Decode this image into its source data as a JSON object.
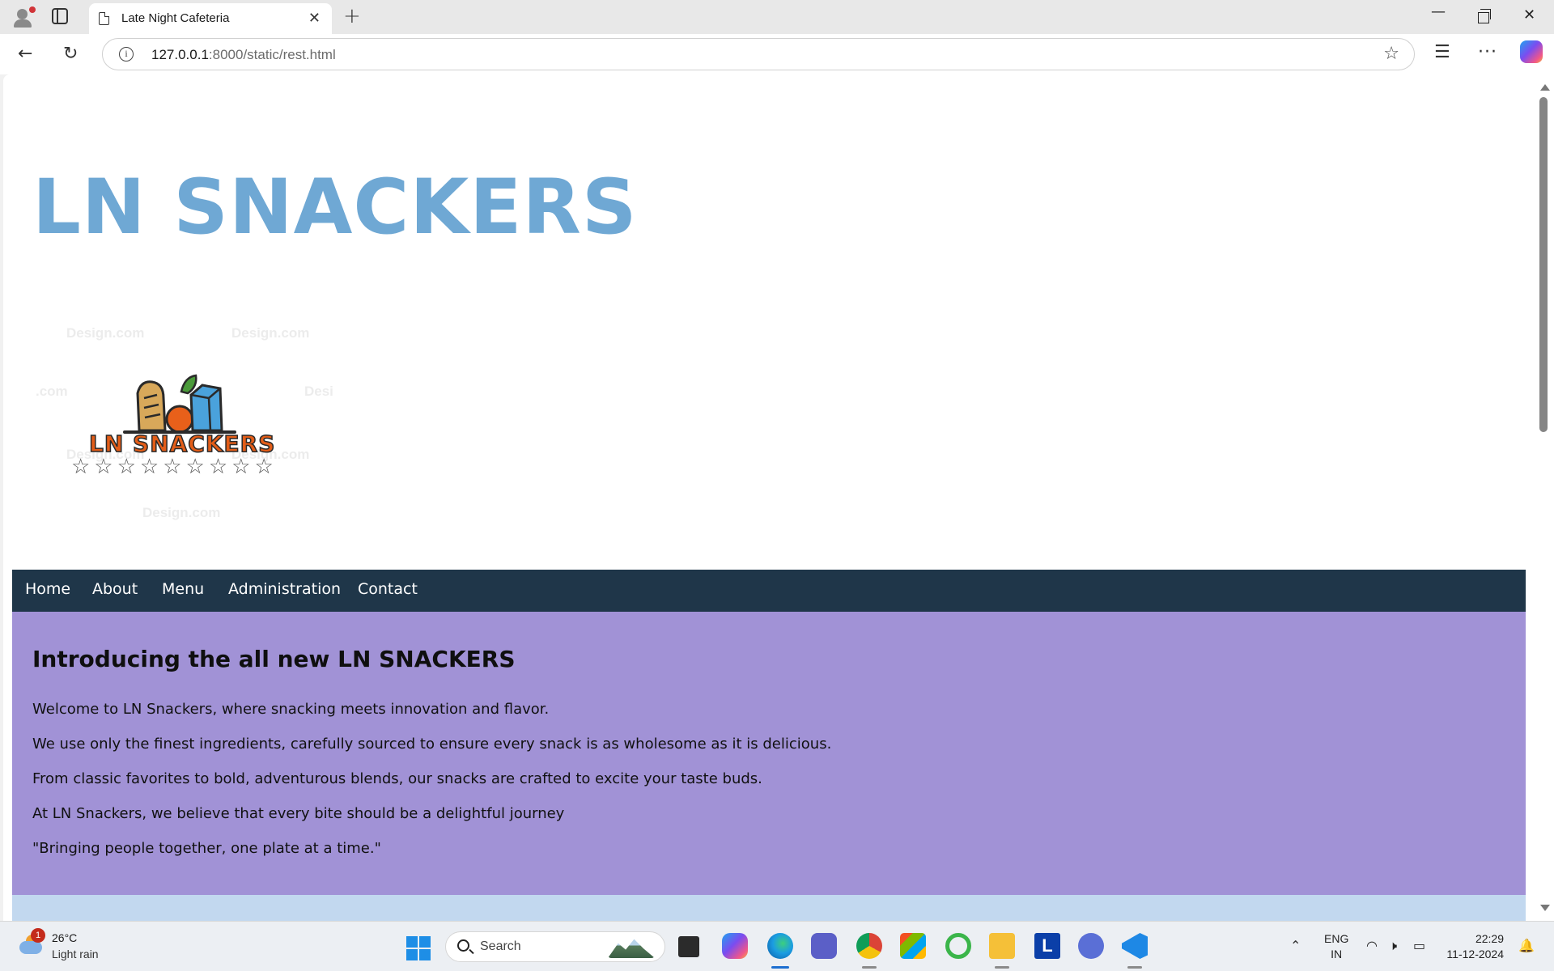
{
  "browser": {
    "tab_title": "Late Night Cafeteria",
    "tab_close_glyph": "✕",
    "new_tab_glyph": "+",
    "url_host": "127.0.0.1",
    "url_rest": ":8000/static/rest.html",
    "window_controls": {
      "minimize": "—",
      "close": "✕"
    },
    "more_glyph": "···"
  },
  "page": {
    "title": "LN SNACKERS",
    "logo_text": "LN SNACKERS",
    "stars": "☆☆☆☆☆☆☆☆☆",
    "watermarks": [
      "Design.com",
      "Design.com",
      ".com",
      "Desi",
      "Design.com",
      "Design.com",
      "Design.com"
    ],
    "nav": [
      "Home",
      "About",
      "Menu",
      "Administration",
      "Contact"
    ],
    "intro": {
      "heading": "Introducing the all new LN SNACKERS",
      "lines": [
        "Welcome to LN Snackers, where snacking meets innovation and flavor.",
        "We use only the finest ingredients, carefully sourced to ensure every snack is as wholesome as it is delicious.",
        "From classic favorites to bold, adventurous blends, our snacks are crafted to excite your taste buds.",
        "At LN Snackers, we believe that every bite should be a delightful journey",
        "\"Bringing people together, one plate at a time.\""
      ]
    },
    "colors": {
      "title": "#6fa8d4",
      "nav_bg": "#1f3649",
      "intro_bg": "#a192d6",
      "next_section_bg": "#c2d8ef"
    }
  },
  "taskbar": {
    "weather_badge": "1",
    "weather_temp": "26°C",
    "weather_desc": "Light rain",
    "search_label": "Search",
    "lang_top": "ENG",
    "lang_bottom": "IN",
    "time": "22:29",
    "date": "11-12-2024",
    "tray_chevron": "⌃",
    "apps": [
      "task-view-icon",
      "copilot-icon",
      "edge-icon",
      "teams-icon",
      "chrome-icon",
      "store-icon",
      "app-ring-icon",
      "file-explorer-icon",
      "l-app-icon",
      "vpn-app-icon",
      "vscode-icon"
    ]
  }
}
